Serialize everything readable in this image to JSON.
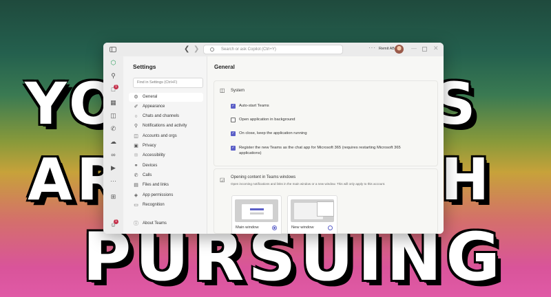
{
  "background_text": {
    "line1_left": "YO",
    "line1_right": "S",
    "line2_left": "AR",
    "line2_right": "H",
    "line3": "PURSUING"
  },
  "titlebar": {
    "search_placeholder": "Search or ask Copilot (Ctrl+Y)",
    "org_name": "Remit AB"
  },
  "settings": {
    "title": "Settings",
    "find_placeholder": "Find in Settings (Ctrl+F)",
    "items": [
      {
        "label": "General",
        "icon": "gear-icon"
      },
      {
        "label": "Appearance",
        "icon": "brush-icon"
      },
      {
        "label": "Chats and channels",
        "icon": "chat-icon"
      },
      {
        "label": "Notifications and activity",
        "icon": "bell-icon"
      },
      {
        "label": "Accounts and orgs",
        "icon": "accounts-icon"
      },
      {
        "label": "Privacy",
        "icon": "lock-icon"
      },
      {
        "label": "Accessibility",
        "icon": "accessibility-icon"
      },
      {
        "label": "Devices",
        "icon": "headset-icon"
      },
      {
        "label": "Calls",
        "icon": "phone-icon"
      },
      {
        "label": "Files and links",
        "icon": "file-icon"
      },
      {
        "label": "App permissions",
        "icon": "shield-icon"
      },
      {
        "label": "Recognition",
        "icon": "recognition-icon"
      }
    ],
    "about": "About Teams"
  },
  "main": {
    "title": "General",
    "system": {
      "label": "System",
      "options": [
        {
          "label": "Auto-start Teams",
          "checked": true
        },
        {
          "label": "Open application in background",
          "checked": false
        },
        {
          "label": "On close, keep the application running",
          "checked": true
        },
        {
          "label": "Register the new Teams as the chat app for Microsoft 365 (requires restarting Microsoft 365",
          "label2": "applications)",
          "checked": true
        }
      ]
    },
    "opening": {
      "title": "Opening content in Teams windows",
      "description": "Open incoming notifications and links in the main window or a new window. This will only apply to this account.",
      "options": [
        {
          "label": "Main window",
          "selected": true
        },
        {
          "label": "New window",
          "selected": false
        }
      ]
    }
  },
  "rail_badges": {
    "chat": "1",
    "account": "1"
  },
  "colors": {
    "accent": "#5b5fc7",
    "badge": "#c4314b"
  }
}
